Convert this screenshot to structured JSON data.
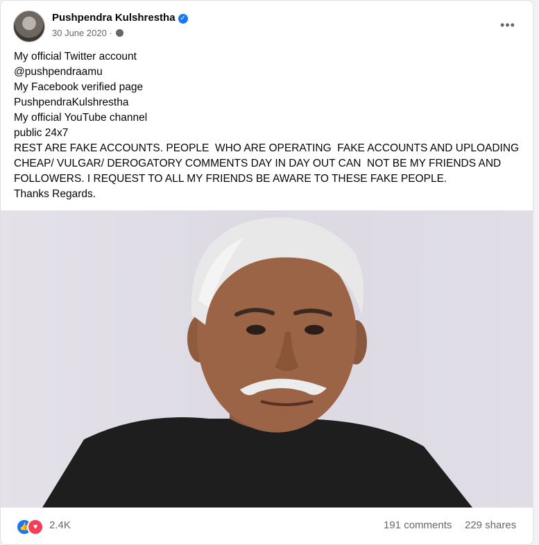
{
  "post": {
    "author": "Pushpendra Kulshrestha",
    "date": "30 June 2020",
    "dot": "·",
    "more_icon": "more-horizontal-icon",
    "verified_icon": "verified-badge-icon",
    "privacy_icon": "globe-icon",
    "lines": [
      "My official Twitter account",
      "@pushpendraamu",
      "My Facebook verified page",
      "PushpendraKulshrestha",
      "My official YouTube channel",
      "public 24x7",
      "REST ARE FAKE ACCOUNTS. PEOPLE  WHO ARE OPERATING  FAKE ACCOUNTS AND UPLOADING",
      "CHEAP/ VULGAR/ DEROGATORY COMMENTS DAY IN DAY OUT CAN  NOT BE MY FRIENDS AND",
      "FOLLOWERS. I REQUEST TO ALL MY FRIENDS BE AWARE TO THESE FAKE PEOPLE.",
      "Thanks Regards."
    ]
  },
  "footer": {
    "reaction_count": "2.4K",
    "comments": "191 comments",
    "shares": "229 shares",
    "like_icon": "like-reaction-icon",
    "love_icon": "love-reaction-icon"
  },
  "colors": {
    "accent": "#1877f2",
    "love": "#f33e58",
    "muted_text": "#65676b"
  }
}
